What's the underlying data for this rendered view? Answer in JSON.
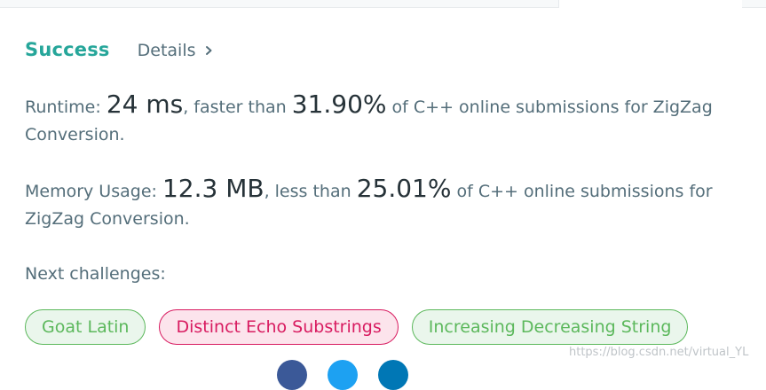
{
  "status": {
    "result": "Success",
    "details_label": "Details"
  },
  "runtime": {
    "label": "Runtime: ",
    "value": "24 ms",
    "mid": ", faster than ",
    "percent": "31.90%",
    "suffix": " of C++ online submissions for ZigZag Conversion."
  },
  "memory": {
    "label": "Memory Usage: ",
    "value": "12.3 MB",
    "mid": ", less than ",
    "percent": "25.01%",
    "suffix": " of C++ online submissions for ZigZag Conversion."
  },
  "next": {
    "label": "Next challenges:",
    "items": [
      {
        "label": "Goat Latin",
        "difficulty": "easy"
      },
      {
        "label": "Distinct Echo Substrings",
        "difficulty": "medium"
      },
      {
        "label": "Increasing Decreasing String",
        "difficulty": "easy"
      }
    ]
  },
  "share_icons": [
    "facebook-icon",
    "twitter-icon",
    "linkedin-icon"
  ],
  "watermark": "https://blog.csdn.net/virtual_YL",
  "colors": {
    "success": "#26a69a",
    "easy": "#5cb85c",
    "medium": "#d81b60",
    "facebook": "#3b5998",
    "twitter": "#1da1f2",
    "linkedin": "#0077b5"
  }
}
